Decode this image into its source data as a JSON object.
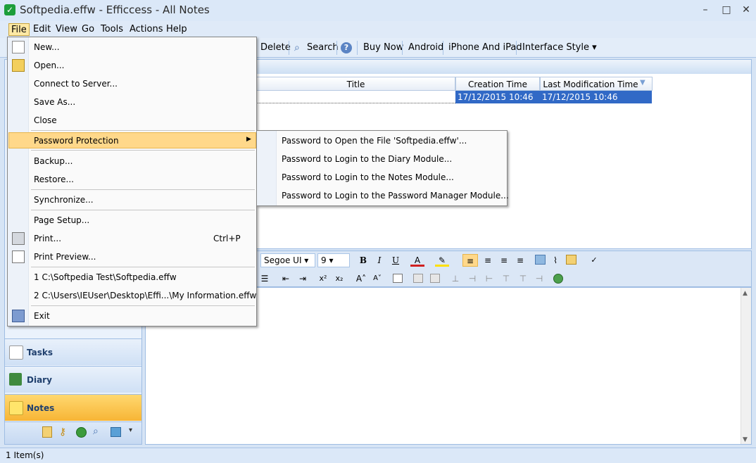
{
  "window": {
    "title": "Softpedia.effw - Efficcess - All Notes",
    "minimize": "–",
    "restore": "□",
    "close": "✕"
  },
  "menubar": [
    "File",
    "Edit",
    "View",
    "Go",
    "Tools",
    "Actions",
    "Help"
  ],
  "toolbar": [
    "Delete",
    "Search",
    "Buy Now",
    "Android",
    "iPhone And iPad",
    "Interface Style ▾"
  ],
  "grid": {
    "columns": [
      "Title",
      "Creation Time",
      "Last Modification Time"
    ],
    "row": {
      "creation": "17/12/2015 10:46",
      "modified": "17/12/2015 10:46"
    }
  },
  "file_menu": {
    "items": [
      {
        "label": "New...",
        "shortcut": ""
      },
      {
        "label": "Open...",
        "shortcut": ""
      },
      {
        "label": "Connect to Server...",
        "shortcut": ""
      },
      {
        "label": "Save As...",
        "shortcut": ""
      },
      {
        "label": "Close",
        "shortcut": ""
      },
      {
        "label": "Password Protection",
        "shortcut": ""
      },
      {
        "label": "Backup...",
        "shortcut": ""
      },
      {
        "label": "Restore...",
        "shortcut": ""
      },
      {
        "label": "Synchronize...",
        "shortcut": ""
      },
      {
        "label": "Page Setup...",
        "shortcut": ""
      },
      {
        "label": "Print...",
        "shortcut": "Ctrl+P"
      },
      {
        "label": "Print Preview...",
        "shortcut": ""
      },
      {
        "label": "1 C:\\Softpedia Test\\Softpedia.effw",
        "shortcut": ""
      },
      {
        "label": "2 C:\\Users\\IEUser\\Desktop\\Effi...\\My Information.effw",
        "shortcut": ""
      },
      {
        "label": "Exit",
        "shortcut": ""
      }
    ]
  },
  "submenu": [
    "Password to Open the File 'Softpedia.effw'...",
    "Password to Login to the Diary Module...",
    "Password to Login to the Notes Module...",
    "Password to Login to the Password Manager Module..."
  ],
  "editor": {
    "font": "Segoe UI",
    "size": "9"
  },
  "nav": [
    "Tasks",
    "Diary",
    "Notes"
  ],
  "status": "1 Item(s)",
  "colors": {
    "accent": "#3169c6",
    "highlight": "#ffd88a",
    "notes_tab": "#f7b535"
  }
}
